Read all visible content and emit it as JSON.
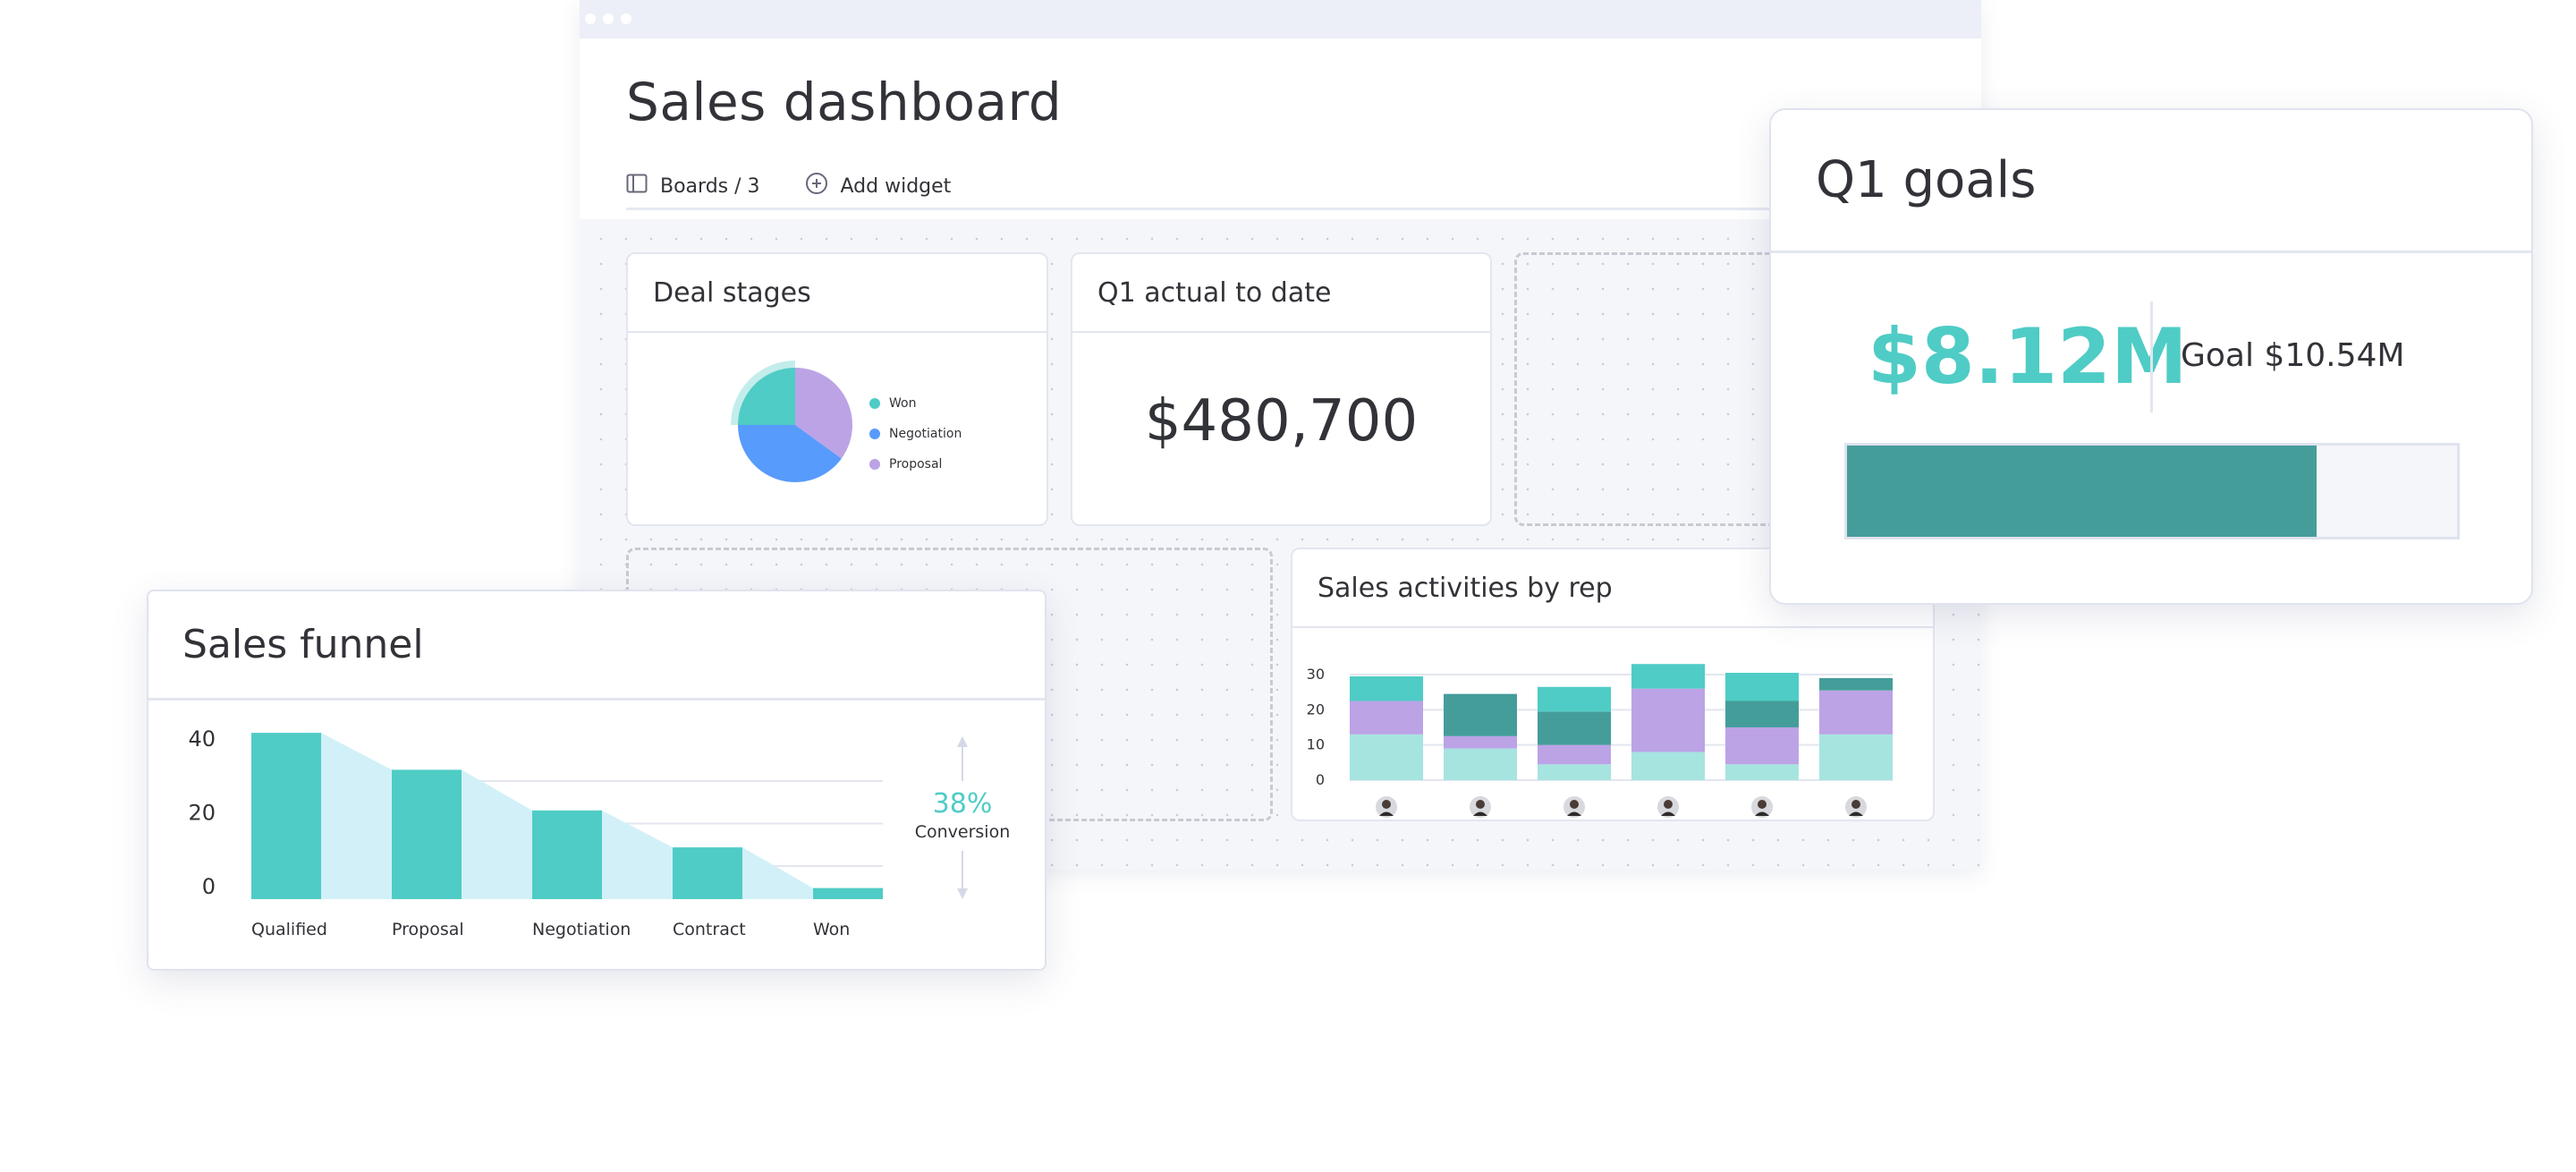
{
  "window": {
    "title": "Sales dashboard",
    "controls": {
      "boards_label": "Boards / 3",
      "boards_icon": "panel-layout-icon",
      "add_widget_label": "Add widget",
      "add_widget_icon": "plus-circle-icon"
    }
  },
  "colors": {
    "teal": "#4fccc5",
    "dark_teal": "#459d9a",
    "light_teal": "#a6e4e0",
    "purple": "#bba3e6",
    "blue": "#579bfc",
    "funnel_fill": "#d2f0f8",
    "text": "#323338",
    "canvas_bg": "#f5f6fa"
  },
  "widgets": {
    "deal_stages": {
      "title": "Deal stages",
      "legend": [
        "Won",
        "Negotiation",
        "Proposal"
      ]
    },
    "q1_actual": {
      "title": "Q1 actual to date",
      "value": "$480,700"
    },
    "sales_activities": {
      "title": "Sales activities by rep",
      "reps": [
        "rep-1-avatar",
        "rep-2-avatar",
        "rep-3-avatar",
        "rep-4-avatar",
        "rep-5-avatar",
        "rep-6-avatar"
      ]
    },
    "q1_goals": {
      "title": "Q1 goals",
      "value": "$8.12M",
      "goal_label": "Goal $10.54M",
      "progress_fraction": 0.77
    },
    "sales_funnel": {
      "title": "Sales funnel",
      "conversion_value": "38%",
      "conversion_label": "Conversion"
    }
  },
  "chart_data": [
    {
      "id": "deal_stages",
      "type": "pie",
      "title": "Deal stages",
      "labels": [
        "Won",
        "Proposal",
        "Negotiation"
      ],
      "values": [
        25,
        35,
        40
      ],
      "highlighted": "Won",
      "legend": "right"
    },
    {
      "id": "sales_funnel",
      "type": "bar",
      "title": "Sales funnel",
      "categories": [
        "Qualified",
        "Proposal",
        "Negotiation",
        "Contract",
        "Won"
      ],
      "values": [
        45,
        35,
        24,
        14,
        3
      ],
      "yticks": [
        0,
        20,
        40
      ],
      "ylim": [
        0,
        46
      ],
      "grid": true,
      "annotation": "38% Conversion"
    },
    {
      "id": "sales_activities",
      "type": "bar",
      "stacked": true,
      "title": "Sales activities by rep",
      "categories": [
        "Rep 1",
        "Rep 2",
        "Rep 3",
        "Rep 4",
        "Rep 5",
        "Rep 6"
      ],
      "yticks": [
        0,
        10,
        20,
        30
      ],
      "ylim": [
        0,
        33
      ],
      "grid": true,
      "series": [
        {
          "name": "light-teal",
          "color": "#a6e4e0",
          "values": [
            13,
            9,
            4.5,
            8,
            4.5,
            13
          ]
        },
        {
          "name": "purple",
          "color": "#bba3e6",
          "values": [
            9.5,
            3.5,
            5.5,
            18,
            10.5,
            12.5
          ]
        },
        {
          "name": "dark-teal",
          "color": "#459d9a",
          "values": [
            0,
            12,
            9.5,
            0,
            7.5,
            3.5
          ]
        },
        {
          "name": "teal",
          "color": "#4fccc5",
          "values": [
            7,
            0,
            7,
            7,
            8,
            0
          ]
        }
      ]
    }
  ]
}
